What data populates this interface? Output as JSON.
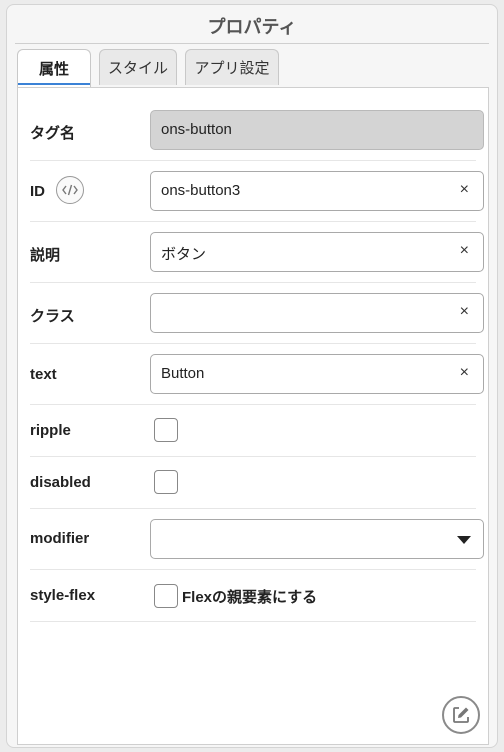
{
  "panel": {
    "title": "プロパティ"
  },
  "tabs": [
    {
      "label": "属性",
      "active": true
    },
    {
      "label": "スタイル",
      "active": false
    },
    {
      "label": "アプリ設定",
      "active": false
    }
  ],
  "fields": {
    "tag": {
      "label": "タグ名",
      "value": "ons-button"
    },
    "id": {
      "label": "ID",
      "value": "ons-button3",
      "clear": "×"
    },
    "description": {
      "label": "説明",
      "value": "ボタン",
      "clear": "×"
    },
    "class": {
      "label": "クラス",
      "value": "",
      "clear": "×"
    },
    "text": {
      "label": "text",
      "value": "Button",
      "clear": "×"
    },
    "ripple": {
      "label": "ripple",
      "checked": false
    },
    "disabled": {
      "label": "disabled",
      "checked": false
    },
    "modifier": {
      "label": "modifier",
      "selected": ""
    },
    "style_flex": {
      "label": "style-flex",
      "checked": false,
      "option_label": "Flexの親要素にする"
    }
  },
  "icons": {
    "code": "code-icon",
    "edit": "edit-icon"
  },
  "colors": {
    "accent": "#3b82d6",
    "readonly_bg": "#d4d4d4"
  }
}
